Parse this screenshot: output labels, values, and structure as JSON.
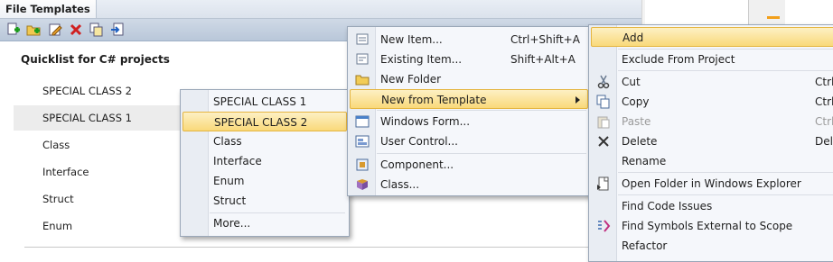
{
  "panel": {
    "title": "File Templates",
    "toolbar_buttons": [
      "add-icon",
      "add-folder-icon",
      "edit-icon",
      "delete-icon",
      "copy-icon",
      "import-icon"
    ],
    "quicklist_header": "Quicklist for C# projects",
    "quicklist": [
      "SPECIAL CLASS 2",
      "SPECIAL CLASS 1",
      "Class",
      "Interface",
      "Struct",
      "Enum"
    ],
    "selected_index": 1
  },
  "submenu_templates": {
    "items": [
      "SPECIAL CLASS 1",
      "SPECIAL CLASS 2",
      "Class",
      "Interface",
      "Enum",
      "Struct"
    ],
    "more": "More...",
    "highlighted": "SPECIAL CLASS 2"
  },
  "submenu_add": {
    "items": [
      {
        "label": "New Item...",
        "shortcut": "Ctrl+Shift+A",
        "icon": "new-item-icon"
      },
      {
        "label": "Existing Item...",
        "shortcut": "Shift+Alt+A",
        "icon": "existing-item-icon"
      },
      {
        "label": "New Folder",
        "shortcut": "",
        "icon": "folder-icon"
      },
      {
        "label": "New from Template",
        "shortcut": "",
        "icon": "",
        "highlighted": true
      },
      {
        "label": "Windows Form...",
        "shortcut": "",
        "icon": "windows-form-icon"
      },
      {
        "label": "User Control...",
        "shortcut": "",
        "icon": "user-control-icon"
      },
      {
        "label": "Component...",
        "shortcut": "",
        "icon": "component-icon"
      },
      {
        "label": "Class...",
        "shortcut": "",
        "icon": "class-icon"
      }
    ]
  },
  "context_menu": {
    "items": [
      {
        "label": "Add",
        "shortcut": "",
        "highlighted": true
      },
      {
        "label": "Exclude From Project",
        "shortcut": ""
      },
      {
        "label": "Cut",
        "shortcut": "Ctrl-",
        "icon": "cut-icon"
      },
      {
        "label": "Copy",
        "shortcut": "Ctrl-",
        "icon": "copy-icon"
      },
      {
        "label": "Paste",
        "shortcut": "Ctrl-",
        "icon": "paste-icon",
        "disabled": true
      },
      {
        "label": "Delete",
        "shortcut": "Del",
        "icon": "delete-icon"
      },
      {
        "label": "Rename",
        "shortcut": ""
      },
      {
        "label": "Open Folder in Windows Explorer",
        "shortcut": "",
        "icon": "explorer-icon"
      },
      {
        "label": "Find Code Issues",
        "shortcut": ""
      },
      {
        "label": "Find Symbols External to Scope",
        "shortcut": "",
        "icon": "find-symbols-icon"
      },
      {
        "label": "Refactor",
        "shortcut": ""
      }
    ]
  },
  "colors": {
    "highlight": "#f9d97a",
    "menu_bg": "#f5f7fb",
    "toolbar": "#c4d0df"
  }
}
